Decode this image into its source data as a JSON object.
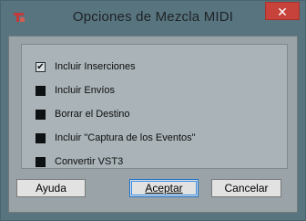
{
  "window": {
    "title": "Opciones de Mezcla MIDI",
    "close_label": "✕",
    "icon": "cubase-logo-icon"
  },
  "options": [
    {
      "label": "Incluir Inserciones",
      "checked": true
    },
    {
      "label": "Incluir Envíos",
      "checked": false
    },
    {
      "label": "Borrar el Destino",
      "checked": false
    },
    {
      "label": "Incluir \"Captura de los Eventos\"",
      "checked": false
    },
    {
      "label": "Convertir VST3",
      "checked": false
    }
  ],
  "buttons": {
    "help": "Ayuda",
    "accept": "Aceptar",
    "cancel": "Cancelar"
  },
  "check_mark": "✔"
}
